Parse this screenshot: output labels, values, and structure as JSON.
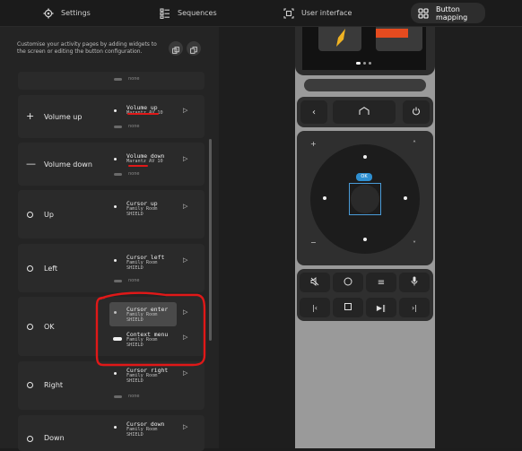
{
  "tabs": [
    {
      "label": "Settings",
      "icon": "gear-icon"
    },
    {
      "label": "Sequences",
      "icon": "sequence-icon"
    },
    {
      "label": "User interface",
      "icon": "user-interface-icon"
    },
    {
      "label": "Button mapping",
      "icon": "grid-icon",
      "active": true
    }
  ],
  "intro": "Customise your activity pages by adding widgets to the screen or editing the button configuration.",
  "none_text": "none",
  "buttons": [
    {
      "label": "Volume up",
      "action": "Volume up",
      "device": "Marantz AV 10"
    },
    {
      "label": "Volume down",
      "action": "Volume down",
      "device": "Marantz AV 10"
    },
    {
      "label": "Up",
      "action": "Cursor up",
      "room": "Family Room",
      "device": "SHIELD"
    },
    {
      "label": "Left",
      "action": "Cursor left",
      "room": "Family Room",
      "device": "SHIELD"
    },
    {
      "label": "OK",
      "action": "Cursor enter",
      "room": "Family Room",
      "device": "SHIELD",
      "long_action": "Context menu",
      "long_room": "Family Room",
      "long_device": "SHIELD"
    },
    {
      "label": "Right",
      "action": "Cursor right",
      "room": "Family Room",
      "device": "SHIELD"
    },
    {
      "label": "Down",
      "action": "Cursor down",
      "room": "Family Room",
      "device": "SHIELD"
    }
  ],
  "remote": {
    "ok_badge": "OK"
  },
  "colors": {
    "accent_red": "#e01818",
    "ok_blue": "#2f8fd0"
  }
}
